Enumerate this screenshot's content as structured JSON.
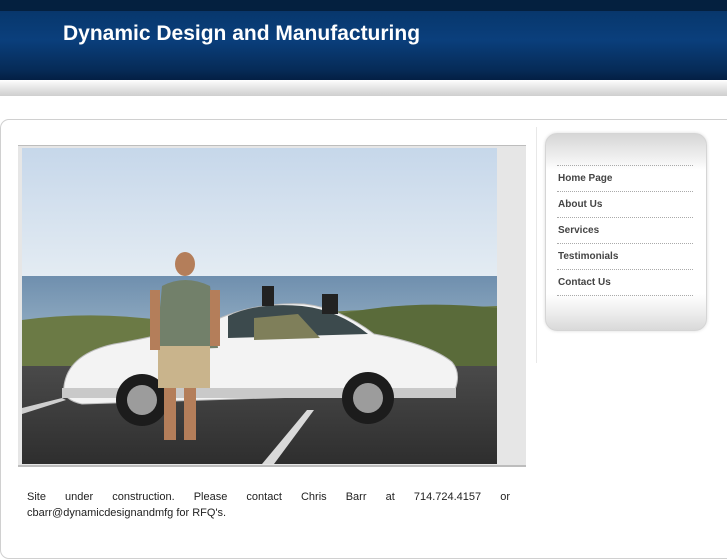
{
  "site": {
    "title": "Dynamic Design and Manufacturing"
  },
  "nav": {
    "items": [
      {
        "label": "Home Page"
      },
      {
        "label": "About Us"
      },
      {
        "label": "Services"
      },
      {
        "label": "Testimonials"
      },
      {
        "label": "Contact Us"
      }
    ]
  },
  "main": {
    "notice": "Site under construction.     Please contact Chris Barr at 714.724.4157 or cbarr@dynamicdesignandmfg for RFQ's."
  },
  "colors": {
    "header_bg": "#0a3f7c",
    "title_text": "#ffffff",
    "nav_text": "#444444"
  }
}
